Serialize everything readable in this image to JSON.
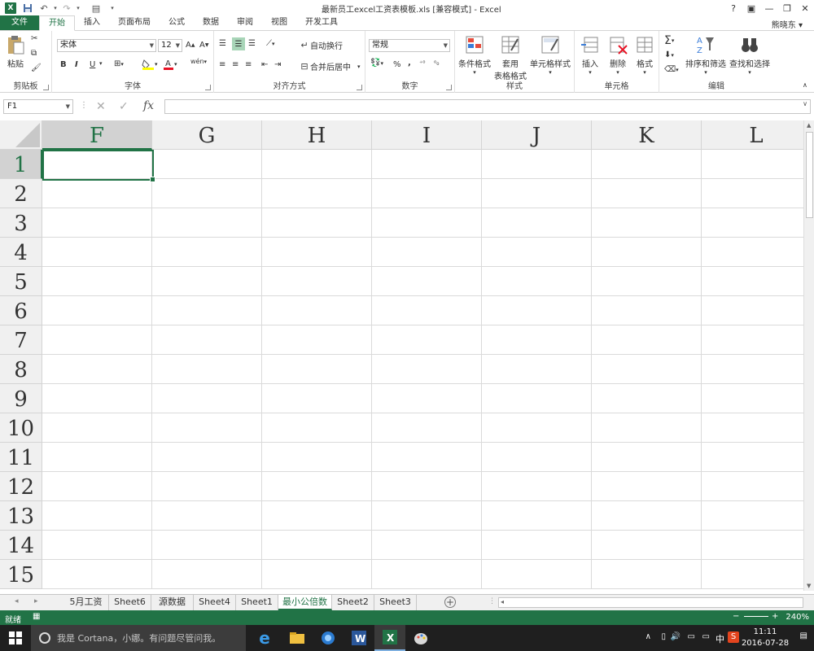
{
  "app": {
    "title": "最新员工excel工资表模板.xls  [兼容模式] - Excel",
    "logo": "X",
    "user": "熊晓东"
  },
  "tabs": [
    "文件",
    "开始",
    "插入",
    "页面布局",
    "公式",
    "数据",
    "审阅",
    "视图",
    "开发工具"
  ],
  "ribbon": {
    "clipboard": {
      "label": "剪贴板",
      "paste": "粘贴"
    },
    "font": {
      "label": "字体",
      "name": "宋体",
      "size": "12",
      "bold": "B",
      "italic": "I",
      "underline": "U"
    },
    "alignment": {
      "label": "对齐方式",
      "wrap": "自动换行",
      "merge": "合并后居中"
    },
    "number": {
      "label": "数字",
      "format": "常规",
      "percent": "%"
    },
    "styles": {
      "label": "样式",
      "conditional": "条件格式",
      "table1": "套用",
      "table2": "表格格式",
      "cell": "单元格样式"
    },
    "cells": {
      "label": "单元格",
      "insert": "插入",
      "delete": "删除",
      "format": "格式"
    },
    "editing": {
      "label": "编辑",
      "sort": "排序和筛选",
      "find": "查找和选择"
    }
  },
  "formula_bar": {
    "name_box": "F1",
    "fx": "fx"
  },
  "grid": {
    "columns": [
      "F",
      "G",
      "H",
      "I",
      "J",
      "K",
      "L"
    ],
    "rows": [
      "1",
      "2",
      "3",
      "4",
      "5",
      "6",
      "7",
      "8",
      "9",
      "10",
      "11",
      "12",
      "13",
      "14",
      "15"
    ],
    "selected_col": "F",
    "selected_row": "1"
  },
  "sheets": [
    "5月工资",
    "Sheet6",
    "源数据",
    "Sheet4",
    "Sheet1",
    "最小公倍数",
    "Sheet2",
    "Sheet3"
  ],
  "active_sheet": "最小公倍数",
  "status": {
    "ready": "就绪",
    "zoom": "240%"
  },
  "taskbar": {
    "cortana": "我是 Cortana，小娜。有问题尽管问我。",
    "ime": "中",
    "time": "11:11",
    "date": "2016-07-28"
  },
  "colors": {
    "excel_green": "#217346"
  }
}
